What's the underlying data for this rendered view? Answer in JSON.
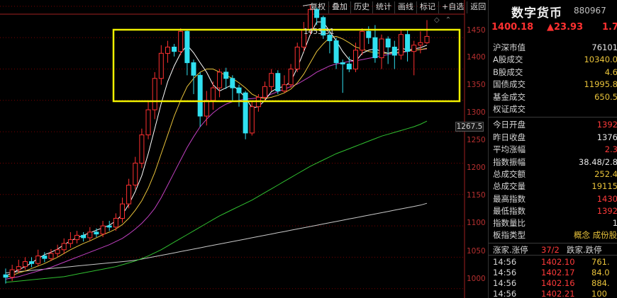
{
  "toolbar": {
    "buttons": [
      "复权",
      "叠加",
      "历史",
      "统计",
      "画线",
      "标记",
      "+自选",
      "返回"
    ]
  },
  "chart": {
    "peak_label": "1453.31",
    "current_value_tag": "1267.5",
    "y_ticks": [
      "1450",
      "1400",
      "1350",
      "1300",
      "1250",
      "1200",
      "1150",
      "1100",
      "1050",
      "1000"
    ],
    "colors": {
      "up": "#ff3030",
      "down": "#30e0f0",
      "ma5": "#ffffff",
      "ma10": "#e8c23a",
      "ma20": "#c040c0",
      "ma60": "#30c030",
      "ma120": "#c8c8c8",
      "highlight_box": "#f0f000",
      "grid": "#7a0000"
    }
  },
  "chart_data": {
    "type": "candlestick",
    "ylim": [
      985,
      1460
    ],
    "candles": [
      {
        "o": 1022,
        "c": 1018,
        "h": 1032,
        "l": 1008
      },
      {
        "o": 1018,
        "c": 1030,
        "h": 1038,
        "l": 1012
      },
      {
        "o": 1030,
        "c": 1035,
        "h": 1046,
        "l": 1025
      },
      {
        "o": 1035,
        "c": 1043,
        "h": 1050,
        "l": 1030
      },
      {
        "o": 1043,
        "c": 1040,
        "h": 1050,
        "l": 1034
      },
      {
        "o": 1040,
        "c": 1052,
        "h": 1062,
        "l": 1036
      },
      {
        "o": 1052,
        "c": 1048,
        "h": 1058,
        "l": 1042
      },
      {
        "o": 1048,
        "c": 1056,
        "h": 1063,
        "l": 1044
      },
      {
        "o": 1056,
        "c": 1062,
        "h": 1070,
        "l": 1050
      },
      {
        "o": 1062,
        "c": 1072,
        "h": 1080,
        "l": 1055
      },
      {
        "o": 1072,
        "c": 1078,
        "h": 1090,
        "l": 1065
      },
      {
        "o": 1078,
        "c": 1085,
        "h": 1092,
        "l": 1072
      },
      {
        "o": 1085,
        "c": 1081,
        "h": 1090,
        "l": 1075
      },
      {
        "o": 1081,
        "c": 1090,
        "h": 1098,
        "l": 1076
      },
      {
        "o": 1090,
        "c": 1087,
        "h": 1096,
        "l": 1082
      },
      {
        "o": 1087,
        "c": 1100,
        "h": 1108,
        "l": 1082
      },
      {
        "o": 1100,
        "c": 1098,
        "h": 1108,
        "l": 1092
      },
      {
        "o": 1098,
        "c": 1112,
        "h": 1120,
        "l": 1092
      },
      {
        "o": 1112,
        "c": 1135,
        "h": 1145,
        "l": 1105
      },
      {
        "o": 1135,
        "c": 1165,
        "h": 1175,
        "l": 1128
      },
      {
        "o": 1165,
        "c": 1200,
        "h": 1210,
        "l": 1158
      },
      {
        "o": 1200,
        "c": 1245,
        "h": 1255,
        "l": 1192
      },
      {
        "o": 1245,
        "c": 1285,
        "h": 1298,
        "l": 1238
      },
      {
        "o": 1285,
        "c": 1335,
        "h": 1345,
        "l": 1270
      },
      {
        "o": 1335,
        "c": 1375,
        "h": 1388,
        "l": 1325
      },
      {
        "o": 1375,
        "c": 1385,
        "h": 1395,
        "l": 1360
      },
      {
        "o": 1385,
        "c": 1378,
        "h": 1390,
        "l": 1370
      },
      {
        "o": 1378,
        "c": 1410,
        "h": 1415,
        "l": 1372
      },
      {
        "o": 1410,
        "c": 1360,
        "h": 1412,
        "l": 1340
      },
      {
        "o": 1360,
        "c": 1340,
        "h": 1365,
        "l": 1310
      },
      {
        "o": 1340,
        "c": 1275,
        "h": 1345,
        "l": 1258
      },
      {
        "o": 1275,
        "c": 1300,
        "h": 1315,
        "l": 1260
      },
      {
        "o": 1300,
        "c": 1320,
        "h": 1330,
        "l": 1285
      },
      {
        "o": 1320,
        "c": 1345,
        "h": 1350,
        "l": 1305
      },
      {
        "o": 1345,
        "c": 1335,
        "h": 1352,
        "l": 1318
      },
      {
        "o": 1335,
        "c": 1320,
        "h": 1340,
        "l": 1300
      },
      {
        "o": 1320,
        "c": 1312,
        "h": 1325,
        "l": 1290
      },
      {
        "o": 1312,
        "c": 1248,
        "h": 1315,
        "l": 1238
      },
      {
        "o": 1248,
        "c": 1290,
        "h": 1298,
        "l": 1244
      },
      {
        "o": 1290,
        "c": 1305,
        "h": 1310,
        "l": 1282
      },
      {
        "o": 1305,
        "c": 1322,
        "h": 1330,
        "l": 1298
      },
      {
        "o": 1322,
        "c": 1343,
        "h": 1350,
        "l": 1315
      },
      {
        "o": 1343,
        "c": 1315,
        "h": 1348,
        "l": 1310
      },
      {
        "o": 1315,
        "c": 1325,
        "h": 1340,
        "l": 1312
      },
      {
        "o": 1325,
        "c": 1350,
        "h": 1358,
        "l": 1320
      },
      {
        "o": 1350,
        "c": 1385,
        "h": 1392,
        "l": 1345
      },
      {
        "o": 1385,
        "c": 1413,
        "h": 1425,
        "l": 1378
      },
      {
        "o": 1413,
        "c": 1445,
        "h": 1453,
        "l": 1405
      },
      {
        "o": 1445,
        "c": 1432,
        "h": 1448,
        "l": 1420
      },
      {
        "o": 1432,
        "c": 1404,
        "h": 1435,
        "l": 1398
      },
      {
        "o": 1404,
        "c": 1395,
        "h": 1410,
        "l": 1375
      },
      {
        "o": 1395,
        "c": 1360,
        "h": 1400,
        "l": 1350
      },
      {
        "o": 1360,
        "c": 1358,
        "h": 1365,
        "l": 1312
      },
      {
        "o": 1358,
        "c": 1350,
        "h": 1370,
        "l": 1345
      },
      {
        "o": 1350,
        "c": 1380,
        "h": 1392,
        "l": 1345
      },
      {
        "o": 1380,
        "c": 1410,
        "h": 1415,
        "l": 1372
      },
      {
        "o": 1410,
        "c": 1400,
        "h": 1418,
        "l": 1390
      },
      {
        "o": 1400,
        "c": 1368,
        "h": 1420,
        "l": 1360
      },
      {
        "o": 1368,
        "c": 1398,
        "h": 1405,
        "l": 1350
      },
      {
        "o": 1398,
        "c": 1385,
        "h": 1402,
        "l": 1358
      },
      {
        "o": 1385,
        "c": 1372,
        "h": 1395,
        "l": 1350
      },
      {
        "o": 1372,
        "c": 1405,
        "h": 1412,
        "l": 1365
      },
      {
        "o": 1405,
        "c": 1378,
        "h": 1412,
        "l": 1362
      },
      {
        "o": 1378,
        "c": 1388,
        "h": 1395,
        "l": 1340
      },
      {
        "o": 1388,
        "c": 1392,
        "h": 1410,
        "l": 1375
      },
      {
        "o": 1392,
        "c": 1402,
        "h": 1428,
        "l": 1390
      }
    ],
    "ma5": [
      1020,
      1025,
      1030,
      1035,
      1041,
      1048,
      1054,
      1058,
      1063,
      1070,
      1076,
      1081,
      1085,
      1089,
      1093,
      1097,
      1101,
      1108,
      1118,
      1134,
      1155,
      1180,
      1215,
      1255,
      1295,
      1330,
      1355,
      1375,
      1388,
      1376,
      1360,
      1345,
      1325,
      1315,
      1320,
      1325,
      1315,
      1305,
      1288,
      1290,
      1300,
      1314,
      1320,
      1322,
      1330,
      1352,
      1378,
      1405,
      1425,
      1425,
      1410,
      1395,
      1378,
      1365,
      1362,
      1375,
      1380,
      1382,
      1378,
      1375,
      1378,
      1384,
      1380,
      1382,
      1384,
      1388
    ],
    "ma10": [
      1018,
      1021,
      1025,
      1028,
      1032,
      1036,
      1040,
      1045,
      1050,
      1056,
      1062,
      1067,
      1072,
      1076,
      1081,
      1086,
      1090,
      1095,
      1102,
      1112,
      1125,
      1140,
      1160,
      1185,
      1215,
      1245,
      1275,
      1300,
      1322,
      1335,
      1345,
      1350,
      1350,
      1345,
      1340,
      1335,
      1328,
      1320,
      1310,
      1305,
      1303,
      1305,
      1308,
      1312,
      1318,
      1328,
      1342,
      1360,
      1378,
      1390,
      1400,
      1402,
      1398,
      1392,
      1385,
      1382,
      1378,
      1376,
      1375,
      1375,
      1376,
      1377,
      1379,
      1380,
      1381,
      1383
    ],
    "ma20": [
      1015,
      1017,
      1019,
      1022,
      1025,
      1028,
      1031,
      1034,
      1038,
      1042,
      1046,
      1050,
      1054,
      1058,
      1062,
      1066,
      1070,
      1075,
      1080,
      1087,
      1095,
      1104,
      1115,
      1128,
      1145,
      1165,
      1185,
      1205,
      1225,
      1242,
      1258,
      1270,
      1280,
      1288,
      1294,
      1298,
      1300,
      1302,
      1303,
      1304,
      1306,
      1310,
      1314,
      1318,
      1322,
      1326,
      1332,
      1338,
      1345,
      1350,
      1355,
      1358,
      1360,
      1362,
      1363,
      1365,
      1367,
      1369,
      1371,
      1373,
      1375,
      1376,
      1378,
      1380,
      1381,
      1382
    ],
    "ma60": [
      1010,
      1011,
      1012,
      1013,
      1014,
      1015,
      1016,
      1017,
      1018,
      1019,
      1021,
      1023,
      1025,
      1027,
      1029,
      1031,
      1033,
      1035,
      1038,
      1041,
      1044,
      1048,
      1052,
      1057,
      1062,
      1068,
      1074,
      1080,
      1086,
      1092,
      1098,
      1104,
      1110,
      1116,
      1121,
      1126,
      1131,
      1136,
      1141,
      1147,
      1153,
      1159,
      1165,
      1171,
      1177,
      1183,
      1189,
      1195,
      1200,
      1205,
      1210,
      1215,
      1219,
      1223,
      1227,
      1231,
      1235,
      1239,
      1243,
      1246,
      1249,
      1252,
      1255,
      1258,
      1262,
      1267
    ],
    "ma120": [
      1025,
      1026,
      1027,
      1028,
      1029,
      1030,
      1031,
      1032,
      1033,
      1034,
      1035,
      1036,
      1037,
      1038,
      1039,
      1040,
      1041,
      1042,
      1043,
      1044,
      1045,
      1047,
      1049,
      1051,
      1053,
      1055,
      1057,
      1059,
      1061,
      1063,
      1065,
      1067,
      1069,
      1071,
      1073,
      1075,
      1077,
      1079,
      1081,
      1083,
      1085,
      1087,
      1089,
      1091,
      1093,
      1095,
      1097,
      1099,
      1101,
      1103,
      1105,
      1107,
      1109,
      1111,
      1113,
      1115,
      1117,
      1119,
      1121,
      1123,
      1125,
      1127,
      1129,
      1131,
      1133,
      1136
    ]
  },
  "panel": {
    "title": "数字货币",
    "code": "880967",
    "price": "1400.18",
    "change": "▲23.93",
    "change_pct": "1.7",
    "info_group1": [
      {
        "label": "沪深市值",
        "value": "76101",
        "cls": "white"
      },
      {
        "label": "A股成交",
        "value": "10340.0",
        "cls": "yellow"
      },
      {
        "label": "B股成交",
        "value": "4.6",
        "cls": "yellow"
      },
      {
        "label": "国债成交",
        "value": "11995.8",
        "cls": "yellow"
      },
      {
        "label": "基金成交",
        "value": "650.5",
        "cls": "yellow"
      },
      {
        "label": "权证成交",
        "value": "",
        "cls": "yellow"
      }
    ],
    "info_group2": [
      {
        "label": "今日开盘",
        "value": "1392",
        "cls": "red"
      },
      {
        "label": "昨日收盘",
        "value": "1376",
        "cls": "white"
      },
      {
        "label": "平均涨幅",
        "value": "2.3",
        "cls": "red"
      },
      {
        "label": "指数振幅",
        "value": "38.48/2.8",
        "cls": "white"
      },
      {
        "label": "总成交额",
        "value": "252.4",
        "cls": "yellow"
      },
      {
        "label": "总成交量",
        "value": "19115",
        "cls": "yellow"
      },
      {
        "label": "最高指数",
        "value": "1430",
        "cls": "red"
      },
      {
        "label": "最低指数",
        "value": "1392",
        "cls": "red"
      },
      {
        "label": "指数量比",
        "value": "1",
        "cls": "white"
      }
    ],
    "sector_label": "板指类型",
    "sector_value": "概念 成份股",
    "breadth": {
      "up_label": "涨家.涨停",
      "up_value": "37/2",
      "down_label": "跌家.跌停"
    },
    "ticks": [
      {
        "time": "14:56",
        "price": "1402.10",
        "vol": "761."
      },
      {
        "time": "14:56",
        "price": "1402.17",
        "vol": "84.0"
      },
      {
        "time": "14:56",
        "price": "1402.16",
        "vol": "884."
      },
      {
        "time": "14:56",
        "price": "1402.21",
        "vol": "100"
      }
    ]
  }
}
